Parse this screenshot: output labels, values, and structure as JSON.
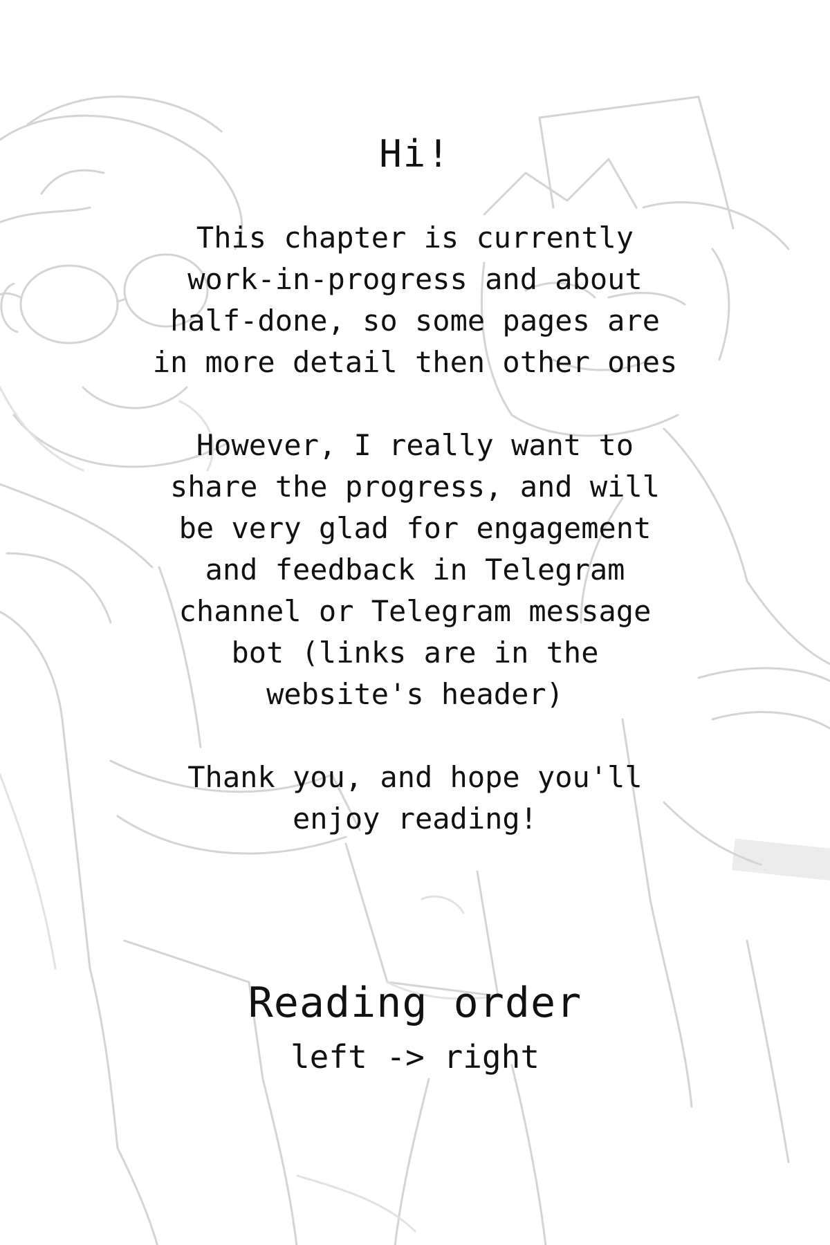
{
  "greeting": "Hi!",
  "notice_lines": [
    "This chapter is currently",
    "work-in-progress and about",
    "half-done, so some pages are",
    "in more detail then other ones"
  ],
  "share_lines": [
    "However, I really want to",
    "share the progress, and will",
    "be very glad for engagement",
    "and feedback in Telegram",
    "channel or Telegram message",
    "bot (links are in the",
    "website's header)"
  ],
  "thanks_lines": [
    "Thank you, and hope you'll",
    "enjoy reading!"
  ],
  "reading_order": {
    "title": "Reading order",
    "direction": "left -> right"
  }
}
